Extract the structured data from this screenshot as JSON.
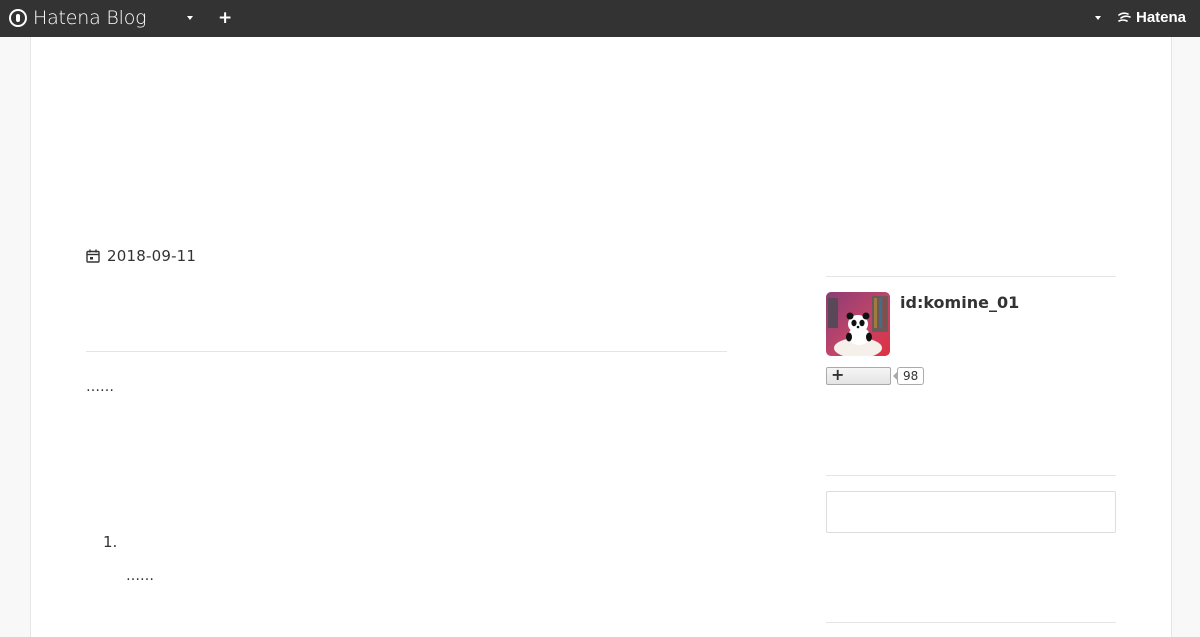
{
  "navbar": {
    "brand": "Hatena Blog",
    "add_label": "+",
    "hatena_brand": "Hatena"
  },
  "article": {
    "date": "2018-09-11",
    "body_ellipsis": "……",
    "list_number": "1.",
    "list_item_text": "……"
  },
  "sidebar": {
    "user_id": "id:komine_01",
    "subscribe_label": "+",
    "subscriber_count": "98",
    "search_placeholder": ""
  },
  "colors": {
    "navbar_bg": "#333333",
    "page_bg": "#f8f8f8",
    "divider": "#e5e5e5"
  }
}
